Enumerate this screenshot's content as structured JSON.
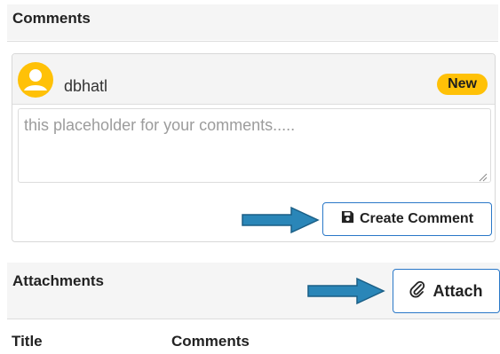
{
  "comments_section": {
    "title": "Comments",
    "comment": {
      "username": "dbhatl",
      "badge": "New",
      "textarea_placeholder": "this placeholder for your comments.....",
      "create_button_label": "Create Comment"
    }
  },
  "attachments_section": {
    "title": "Attachments",
    "attach_button_label": "Attach",
    "columns": [
      "Title",
      "Comments"
    ]
  },
  "colors": {
    "badge": "#ffc107",
    "avatar": "#ffc107",
    "button_border": "#2a78c8",
    "arrow": "#2a86b8"
  },
  "icons": {
    "avatar": "user-avatar-icon",
    "save": "floppy-disk-icon",
    "attach": "paperclip-icon",
    "annotation": "right-arrow-icon"
  }
}
